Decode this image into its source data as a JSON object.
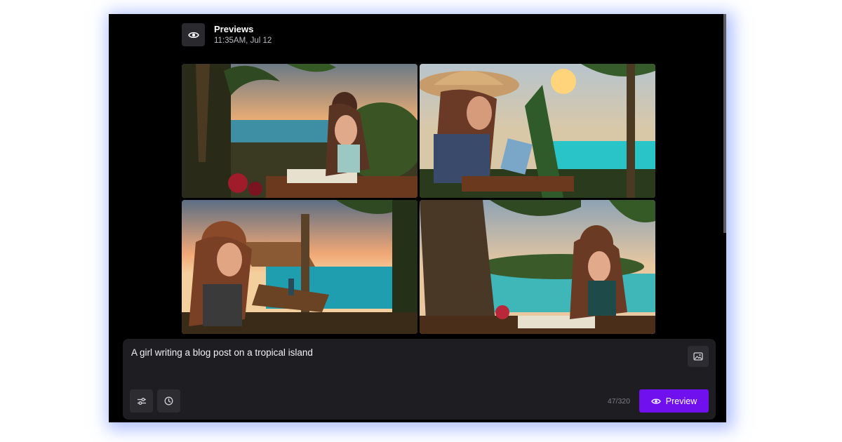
{
  "header": {
    "title": "Previews",
    "timestamp": "11:35AM, Jul 12",
    "icon": "eye-icon"
  },
  "gallery": {
    "images": [
      {
        "description_icon": "image-icon"
      },
      {
        "description_icon": "image-icon"
      },
      {
        "description_icon": "image-icon"
      },
      {
        "description_icon": "image-icon"
      }
    ]
  },
  "prompt": {
    "text": "A girl writing a blog post on a tropical island",
    "counter": "47/320",
    "preview_label": "Preview",
    "icons": {
      "image_upload": "image-icon",
      "settings": "sliders-icon",
      "history": "clock-icon",
      "preview": "eye-icon"
    }
  },
  "colors": {
    "window_bg": "#000000",
    "panel_bg": "#1e1e22",
    "accent": "#7010ee",
    "glow": "#6e8cff"
  }
}
